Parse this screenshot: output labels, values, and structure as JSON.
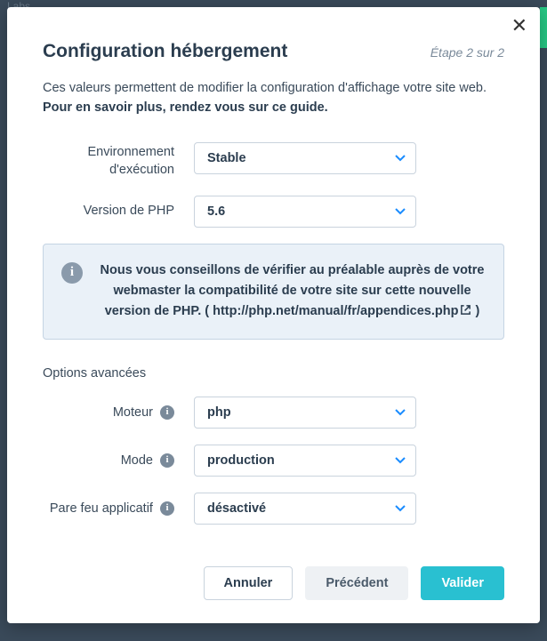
{
  "modal": {
    "title": "Configuration hébergement",
    "step": "Étape 2 sur 2",
    "description": "Ces valeurs permettent de modifier la configuration d'affichage votre site web.",
    "guide_link": "Pour en savoir plus, rendez vous sur ce guide.",
    "fields": {
      "env": {
        "label": "Environnement d'exécution",
        "value": "Stable"
      },
      "php": {
        "label": "Version de PHP",
        "value": "5.6"
      },
      "engine": {
        "label": "Moteur",
        "value": "php"
      },
      "mode": {
        "label": "Mode",
        "value": "production"
      },
      "waf": {
        "label": "Pare feu applicatif",
        "value": "désactivé"
      }
    },
    "info": {
      "text_before": "Nous vous conseillons de vérifier au préalable auprès de votre webmaster la compatibilité de votre site sur cette nouvelle version de PHP. ( ",
      "link": "http://php.net/manual/fr/appendices.php",
      "text_after": " )"
    },
    "advanced_label": "Options avancées",
    "buttons": {
      "cancel": "Annuler",
      "prev": "Précédent",
      "submit": "Valider"
    }
  }
}
